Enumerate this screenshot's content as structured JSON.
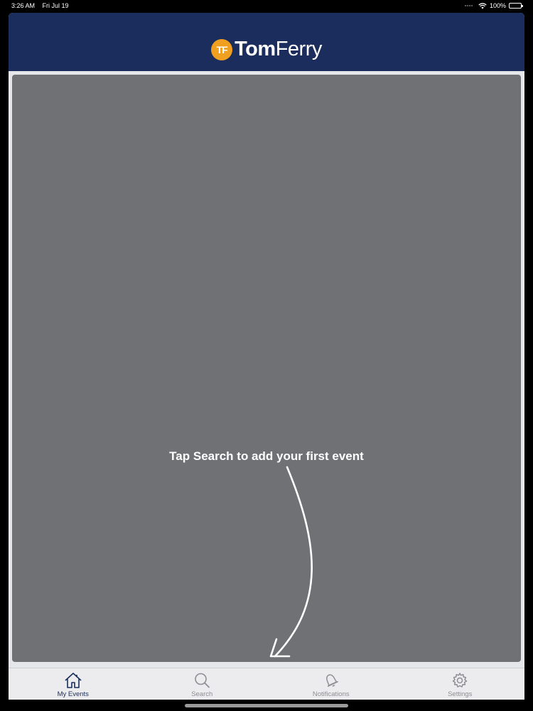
{
  "status_bar": {
    "time": "3:26 AM",
    "date": "Fri Jul 19",
    "battery": "100%",
    "battery_level": 1.0
  },
  "header": {
    "logo_badge": "TF",
    "logo_word1": "Tom",
    "logo_word2": "Ferry"
  },
  "main": {
    "empty_hint": "Tap Search to add your first event"
  },
  "tabbar": {
    "tabs": [
      {
        "label": "My Events",
        "icon": "home-icon",
        "active": true
      },
      {
        "label": "Search",
        "icon": "search-icon",
        "active": false
      },
      {
        "label": "Notifications",
        "icon": "bell-icon",
        "active": false
      },
      {
        "label": "Settings",
        "icon": "gear-icon",
        "active": false
      }
    ]
  },
  "colors": {
    "header_bg": "#1a2d5c",
    "logo_accent": "#f0a020",
    "content_bg": "#6f7175",
    "tabbar_bg": "#ececee",
    "tab_active": "#1a2d5c",
    "tab_inactive": "#8e8e93"
  }
}
